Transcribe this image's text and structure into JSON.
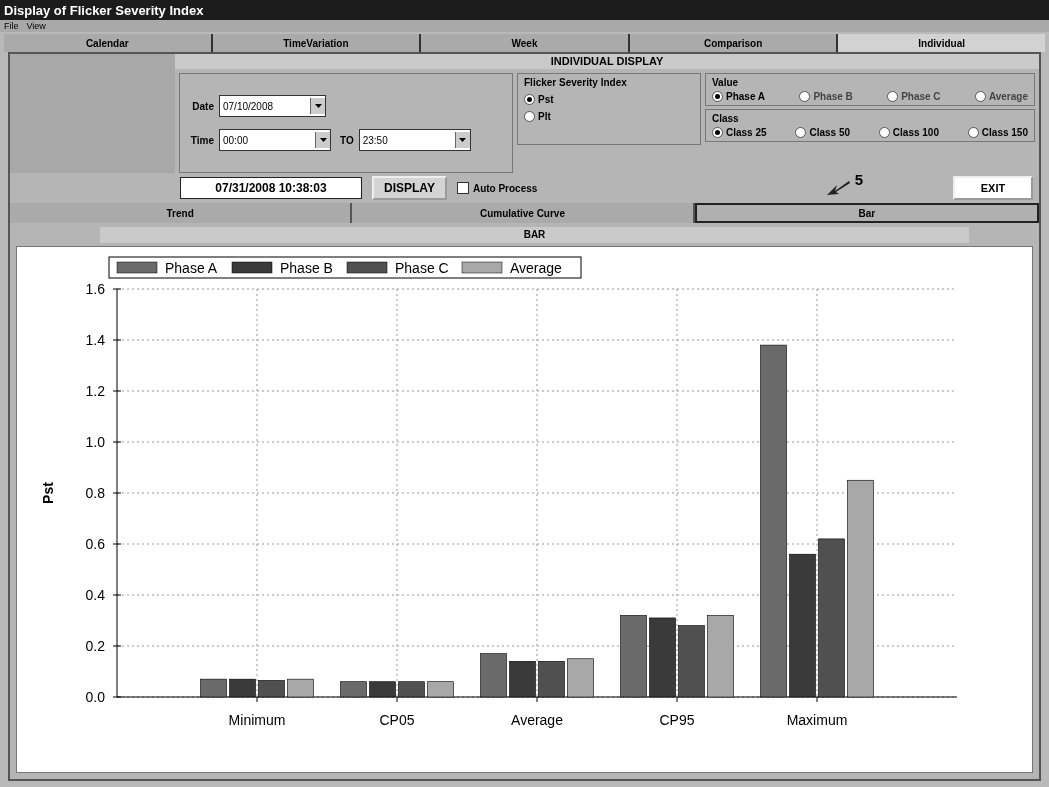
{
  "window": {
    "title": "Display of Flicker Severity Index"
  },
  "menu": [
    "File",
    "View"
  ],
  "tabs": [
    {
      "label": "Calendar",
      "selected": false
    },
    {
      "label": "TimeVariation",
      "selected": false
    },
    {
      "label": "Week",
      "selected": false
    },
    {
      "label": "Comparison",
      "selected": false
    },
    {
      "label": "Individual",
      "selected": true
    }
  ],
  "panel_title": "INDIVIDUAL DISPLAY",
  "date": {
    "label": "Date",
    "value": "07/10/2008"
  },
  "time": {
    "label": "Time",
    "from": "00:00",
    "to_label": "TO",
    "to": "23:50"
  },
  "flicker_index": {
    "title": "Flicker Severity Index",
    "options": [
      {
        "label": "Pst",
        "selected": true
      },
      {
        "label": "Plt",
        "selected": false
      }
    ]
  },
  "value": {
    "title": "Value",
    "options": [
      {
        "label": "Phase A",
        "selected": true
      },
      {
        "label": "Phase B",
        "selected": false
      },
      {
        "label": "Phase C",
        "selected": false
      },
      {
        "label": "Average",
        "selected": false
      }
    ]
  },
  "class": {
    "title": "Class",
    "options": [
      {
        "label": "Class 25",
        "selected": true
      },
      {
        "label": "Class 50",
        "selected": false
      },
      {
        "label": "Class 100",
        "selected": false
      },
      {
        "label": "Class 150",
        "selected": false
      }
    ]
  },
  "timestamp": "07/31/2008 10:38:03",
  "display_button": "DISPLAY",
  "auto_process": {
    "label": "Auto Process",
    "checked": false
  },
  "exit_button": "EXIT",
  "annotation": "5",
  "view_tabs": [
    {
      "label": "Trend",
      "selected": false
    },
    {
      "label": "Cumulative Curve",
      "selected": false
    },
    {
      "label": "Bar",
      "selected": true
    }
  ],
  "chart_title": "BAR",
  "chart_data": {
    "type": "bar",
    "ylabel": "Pst",
    "categories": [
      "Minimum",
      "CP05",
      "Average",
      "CP95",
      "Maximum"
    ],
    "series": [
      {
        "name": "Phase A",
        "color": "#6a6a6a",
        "values": [
          0.07,
          0.06,
          0.17,
          0.32,
          1.38
        ]
      },
      {
        "name": "Phase B",
        "color": "#3a3a3a",
        "values": [
          0.07,
          0.06,
          0.14,
          0.31,
          0.56
        ]
      },
      {
        "name": "Phase C",
        "color": "#505050",
        "values": [
          0.065,
          0.06,
          0.14,
          0.28,
          0.62
        ]
      },
      {
        "name": "Average",
        "color": "#a8a8a8",
        "values": [
          0.07,
          0.06,
          0.15,
          0.32,
          0.85
        ]
      }
    ],
    "ylim": [
      0,
      1.6
    ],
    "grid": true,
    "legend": true,
    "yticks": [
      {
        "value": 0,
        "label": "0.0"
      },
      {
        "value": 0.2,
        "label": "0.2"
      },
      {
        "value": 0.4,
        "label": "0.4"
      },
      {
        "value": 0.6,
        "label": "0.6"
      },
      {
        "value": 0.8,
        "label": "0.8"
      },
      {
        "value": 1,
        "label": "1.0"
      },
      {
        "value": 1.2,
        "label": "1.2"
      },
      {
        "value": 1.4,
        "label": "1.4"
      },
      {
        "value": 1.6,
        "label": "1.6"
      }
    ]
  }
}
